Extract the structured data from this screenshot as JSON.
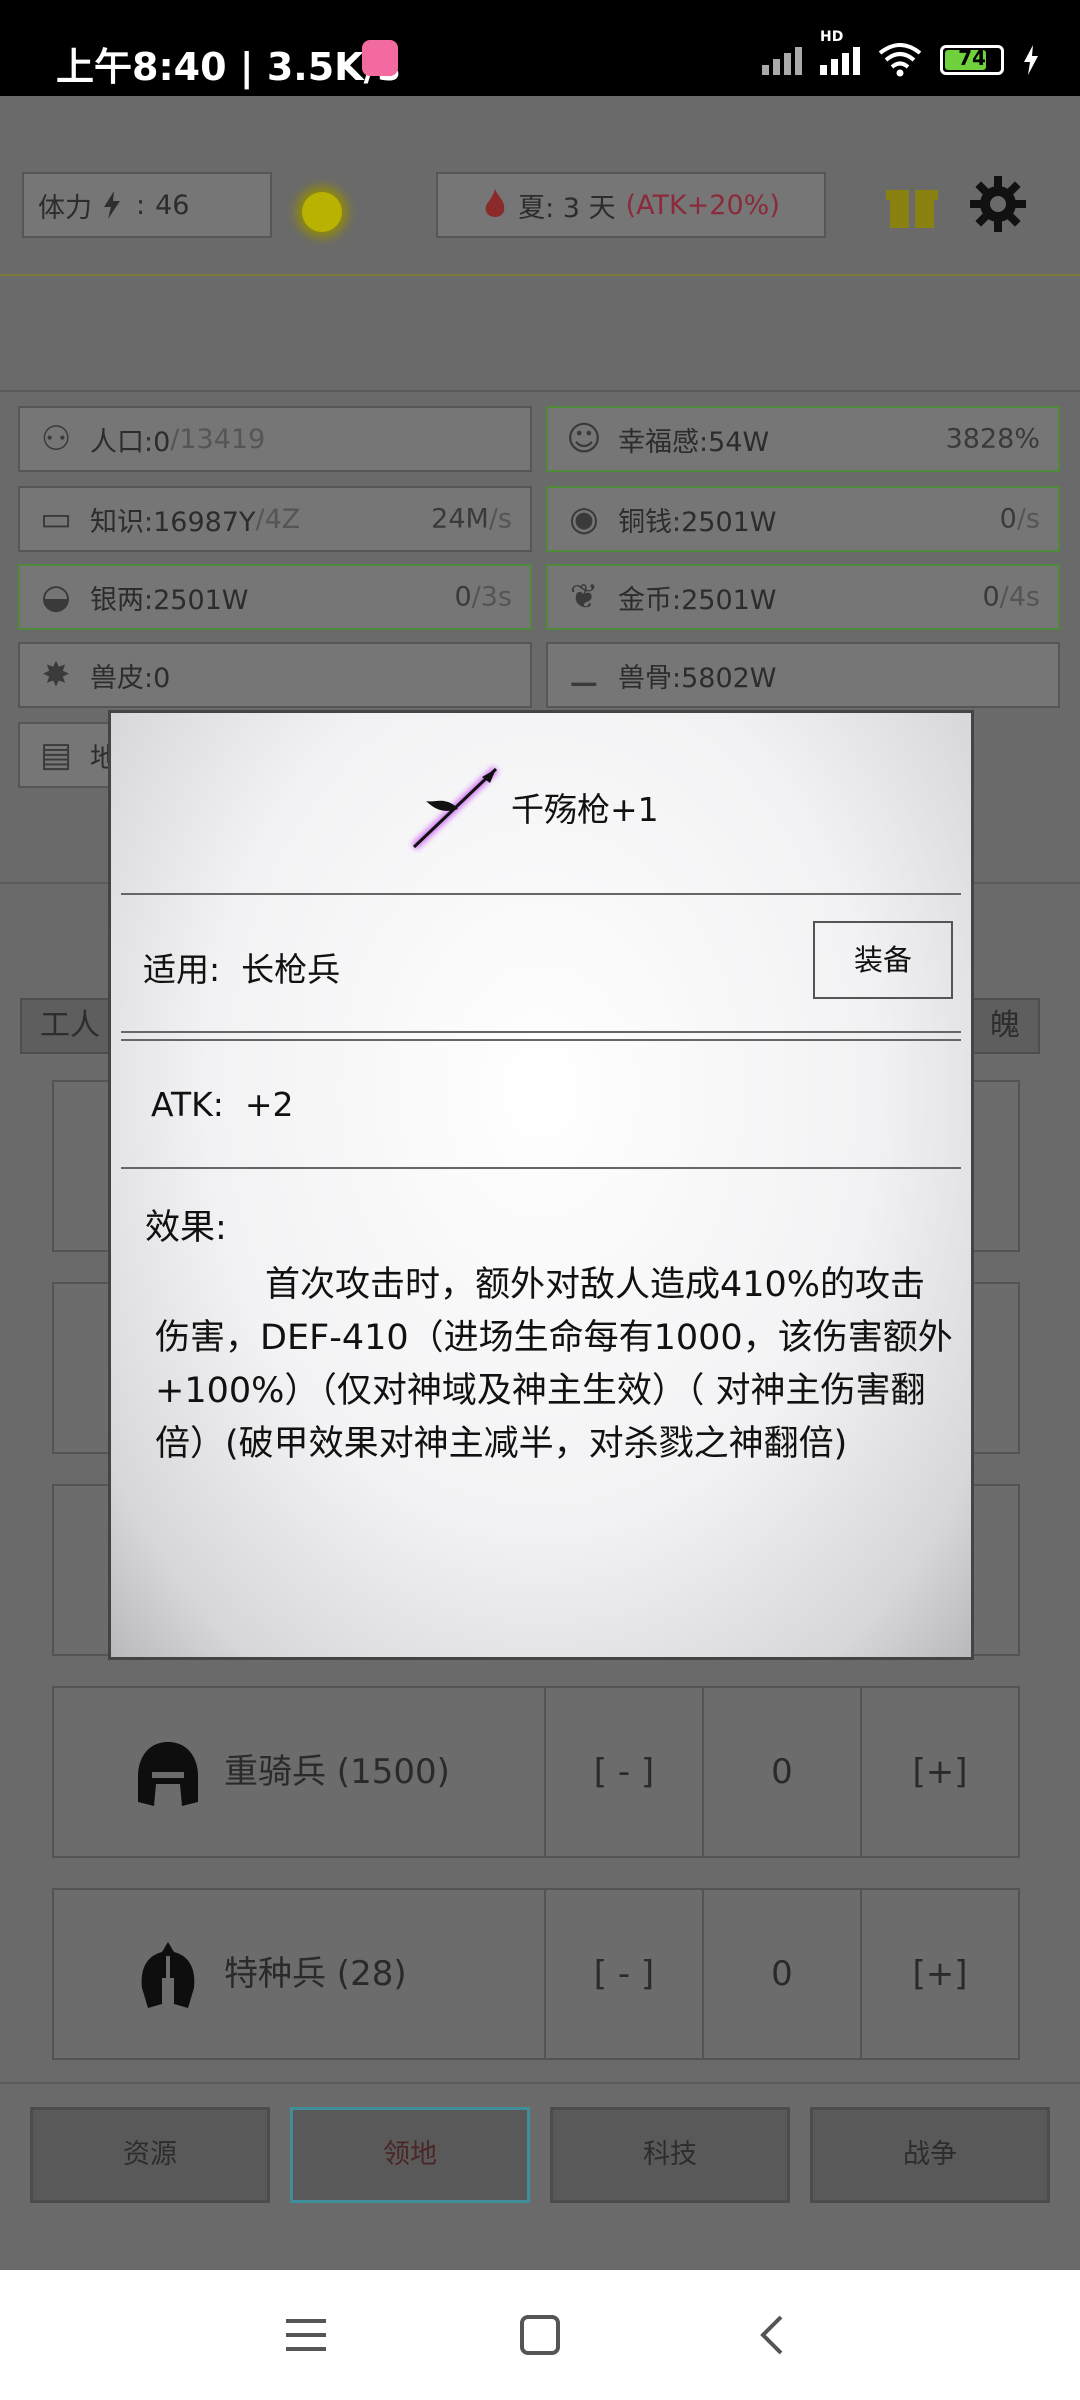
{
  "status_bar": {
    "time": "上午8:40 | 3.5K/s",
    "network_label": "HD",
    "battery_level": "74",
    "battery_fraction": 0.74
  },
  "header": {
    "stamina_label": "体力",
    "stamina_value": "46",
    "season": "夏: 3 天",
    "season_bonus": "(ATK+20%)"
  },
  "resources": [
    {
      "id": "population",
      "label": "人口:0",
      "sub": "/13419",
      "rate": "",
      "rate_unit": "",
      "icon": "people-icon",
      "highlight": false
    },
    {
      "id": "happiness",
      "label": "幸福感:54W",
      "sub": "",
      "rate": "3828%",
      "rate_unit": "",
      "icon": "smile-icon",
      "highlight": true
    },
    {
      "id": "knowledge",
      "label": "知识:16987Y",
      "sub": "/4Z",
      "rate": "24M",
      "rate_unit": "/s",
      "icon": "book-icon",
      "highlight": false
    },
    {
      "id": "copper",
      "label": "铜钱:2501W",
      "sub": "",
      "rate": "0",
      "rate_unit": "/s",
      "icon": "coin-icon",
      "highlight": true
    },
    {
      "id": "silver",
      "label": "银两:2501W",
      "sub": "",
      "rate": "0",
      "rate_unit": "/3s",
      "icon": "ingot-icon",
      "highlight": true
    },
    {
      "id": "gold",
      "label": "金币:2501W",
      "sub": "",
      "rate": "0",
      "rate_unit": "/4s",
      "icon": "leaf-icon",
      "highlight": true
    },
    {
      "id": "hide",
      "label": "兽皮:0",
      "sub": "",
      "rate": "",
      "rate_unit": "",
      "icon": "hide-icon",
      "highlight": false
    },
    {
      "id": "bone",
      "label": "兽骨:5802W",
      "sub": "",
      "rate": "",
      "rate_unit": "",
      "icon": "bone-icon",
      "highlight": false
    },
    {
      "id": "land",
      "label": "地",
      "sub": "",
      "rate": "",
      "rate_unit": "",
      "icon": "scroll-icon",
      "highlight": false
    }
  ],
  "tab_partial_left": "工人",
  "tab_partial_right": "魄",
  "units": [
    {
      "name": "重骑兵 (1500)",
      "minus": "[ - ]",
      "count": "0",
      "plus": "[+]",
      "icon": "helmet-icon"
    },
    {
      "name": "特种兵 (28)",
      "minus": "[ - ]",
      "count": "0",
      "plus": "[+]",
      "icon": "spartan-helmet-icon"
    }
  ],
  "bottom_nav": [
    "资源",
    "领地",
    "科技",
    "战争"
  ],
  "bottom_nav_active": 1,
  "modal": {
    "title": "千殇枪+1",
    "apply_label": "适用:  长枪兵",
    "equip_button": "装备",
    "atk": "ATK:  +2",
    "effect_label": "效果:",
    "effect_text": "首次攻击时，额外对敌人造成410%的攻击伤害，DEF-410（进场生命每有1000，该伤害额外+100%）（仅对神域及神主生效）（ 对神主伤害翻倍）(破甲效果对神主减半，对杀戮之神翻倍)"
  },
  "colors": {
    "season_bonus": "#c81e3c",
    "weapon_glow": "#c23cf0",
    "active_tab_border": "#3f8e9a",
    "green_border": "#4f8a3a"
  }
}
